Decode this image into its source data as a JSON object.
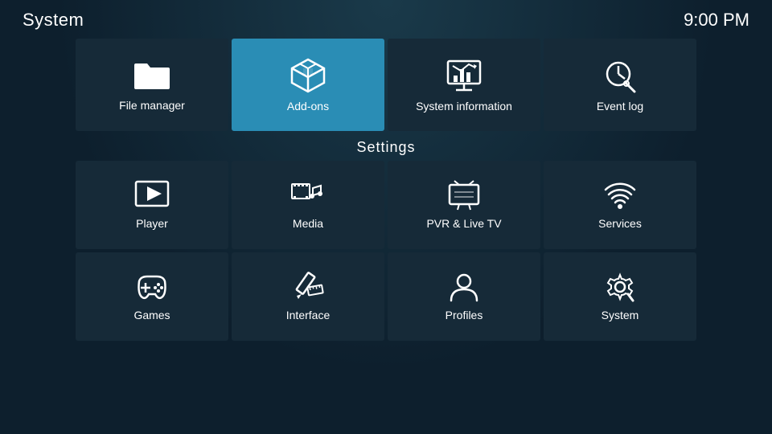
{
  "header": {
    "title": "System",
    "time": "9:00 PM"
  },
  "top_tiles": [
    {
      "id": "file-manager",
      "label": "File manager",
      "icon": "folder"
    },
    {
      "id": "add-ons",
      "label": "Add-ons",
      "icon": "box",
      "active": true
    },
    {
      "id": "system-information",
      "label": "System information",
      "icon": "chart"
    },
    {
      "id": "event-log",
      "label": "Event log",
      "icon": "clock-search"
    }
  ],
  "settings_label": "Settings",
  "settings_tiles": [
    {
      "id": "player",
      "label": "Player",
      "icon": "play"
    },
    {
      "id": "media",
      "label": "Media",
      "icon": "media"
    },
    {
      "id": "pvr-live-tv",
      "label": "PVR & Live TV",
      "icon": "tv"
    },
    {
      "id": "services",
      "label": "Services",
      "icon": "wifi"
    },
    {
      "id": "games",
      "label": "Games",
      "icon": "gamepad"
    },
    {
      "id": "interface",
      "label": "Interface",
      "icon": "pencil"
    },
    {
      "id": "profiles",
      "label": "Profiles",
      "icon": "person"
    },
    {
      "id": "system",
      "label": "System",
      "icon": "gear"
    }
  ]
}
